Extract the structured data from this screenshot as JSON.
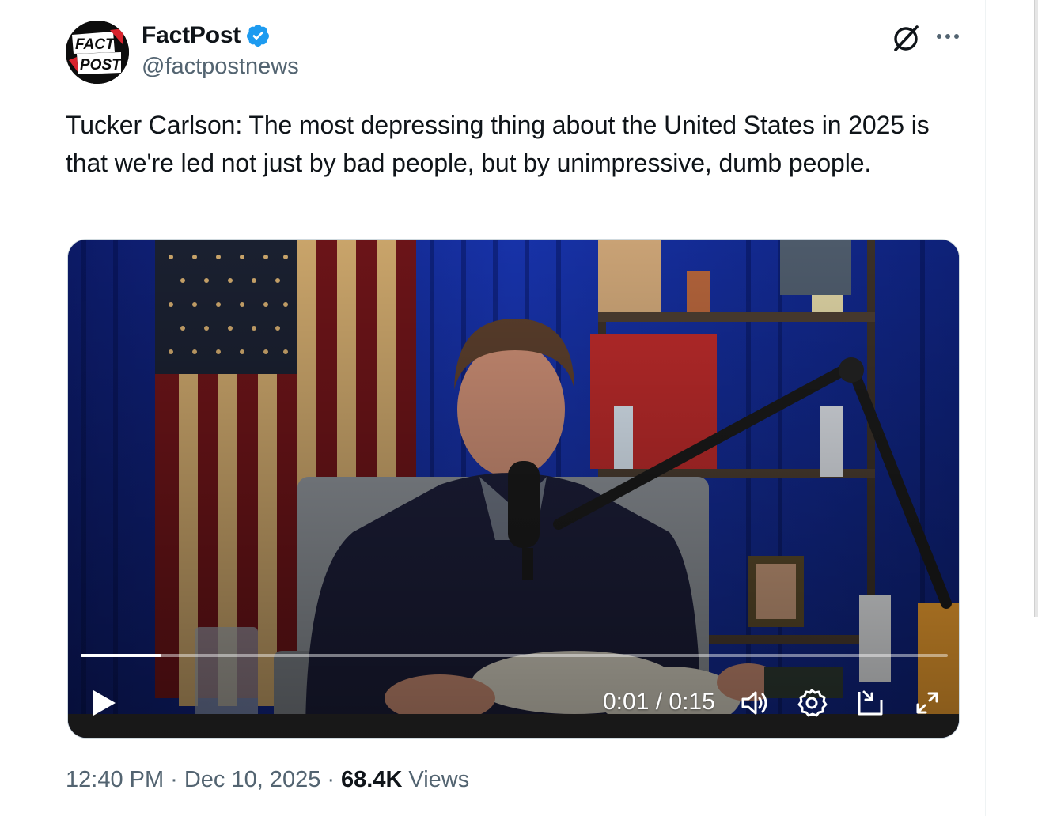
{
  "account": {
    "display_name": "FactPost",
    "handle": "@factpostnews",
    "verified": true,
    "avatar_text_line1": "FACT",
    "avatar_text_line2": "POST"
  },
  "post": {
    "text": "Tucker Carlson: The most depressing thing about the United States in 2025 is that we're led not just by bad people, but by unimpressive, dumb people."
  },
  "video": {
    "time_display": "0:01 / 0:15",
    "progress_fraction": 0.093,
    "controls": [
      "play-icon",
      "volume-icon",
      "settings-icon",
      "pip-icon",
      "fullscreen-icon"
    ]
  },
  "meta": {
    "time": "12:40 PM",
    "separator": "·",
    "date": "Dec 10, 2025",
    "views_count": "68.4K",
    "views_label": "Views"
  },
  "header_icons": [
    "grok-icon",
    "more-icon"
  ],
  "colors": {
    "verified_blue": "#1d9bf0",
    "secondary_text": "#536471",
    "primary_text": "#0f1419",
    "border": "#cfd9de"
  }
}
